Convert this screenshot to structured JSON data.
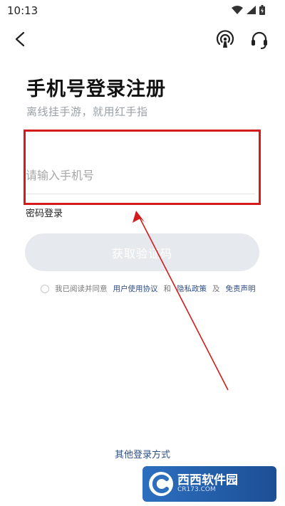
{
  "status_bar": {
    "time": "10:13"
  },
  "header": {
    "back_icon": "chevron-left-icon",
    "cloud_icon": "cloud-signal-icon",
    "support_icon": "headset-icon"
  },
  "page": {
    "title": "手机号登录注册",
    "subtitle": "离线挂手游，就用红手指"
  },
  "form": {
    "phone_placeholder": "请输入手机号",
    "password_login_label": "密码登录",
    "get_code_label": "获取验证码"
  },
  "agreement": {
    "prefix": "我已阅读并同意",
    "user_agreement": "用户使用协议",
    "and": "和",
    "privacy_policy": "隐私政策",
    "and2": "及",
    "disclaimer": "免责声明"
  },
  "footer": {
    "other_login_label": "其他登录方式"
  },
  "watermark": {
    "brand": "西西软件园",
    "sub": "CR173.COM"
  },
  "colors": {
    "accent_link": "#2f4f86",
    "highlight": "#d41b1b",
    "button_disabled": "#e6e9ed"
  }
}
